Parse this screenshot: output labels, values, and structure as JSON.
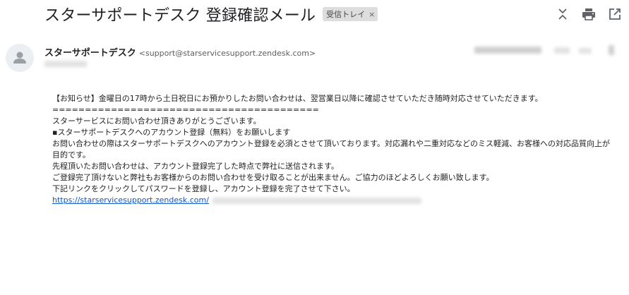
{
  "email": {
    "subject": "スターサポートデスク 登録確認メール",
    "label": "受信トレイ",
    "label_remove": "×",
    "sender_name": "スターサポートデスク",
    "sender_email": "<support@starservicesupport.zendesk.com>",
    "body": {
      "notice": "【お知らせ】金曜日の17時から土日祝日にお預かりしたお問い合わせは、翌営業日以降に確認させていただき随時対応させていただきます。",
      "divider": "=========================================",
      "thanks": "スターサービスにお問い合わせ頂きありがとうございます。",
      "bullet": "▪スターサポートデスクへのアカウント登録（無料）をお願いします",
      "para1": "お問い合わせの際はスターサポートデスクへのアカウント登録を必須とさせて頂いております。対応漏れや二重対応などのミス軽減、お客様への対応品質向上が目的です。",
      "para2": "先程頂いたお問い合わせは、アカウント登録完了した時点で弊社に送信されます。",
      "para3": "ご登録完了頂けないと弊社もお客様からのお問い合わせを受け取ることが出来ません。ご協力のほどよろしくお願い致します。",
      "para4": "下記リンクをクリックしてパスワードを登録し、アカウント登録を完了させて下さい。",
      "link": "https://starservicesupport.zendesk.com/"
    }
  },
  "toolbar": {
    "icons": [
      "collapse-icon",
      "print-icon",
      "open-in-new-window-icon"
    ]
  },
  "colors": {
    "link": "#1155cc",
    "chip_bg": "#dddddd",
    "avatar_bg": "#eceff1"
  }
}
